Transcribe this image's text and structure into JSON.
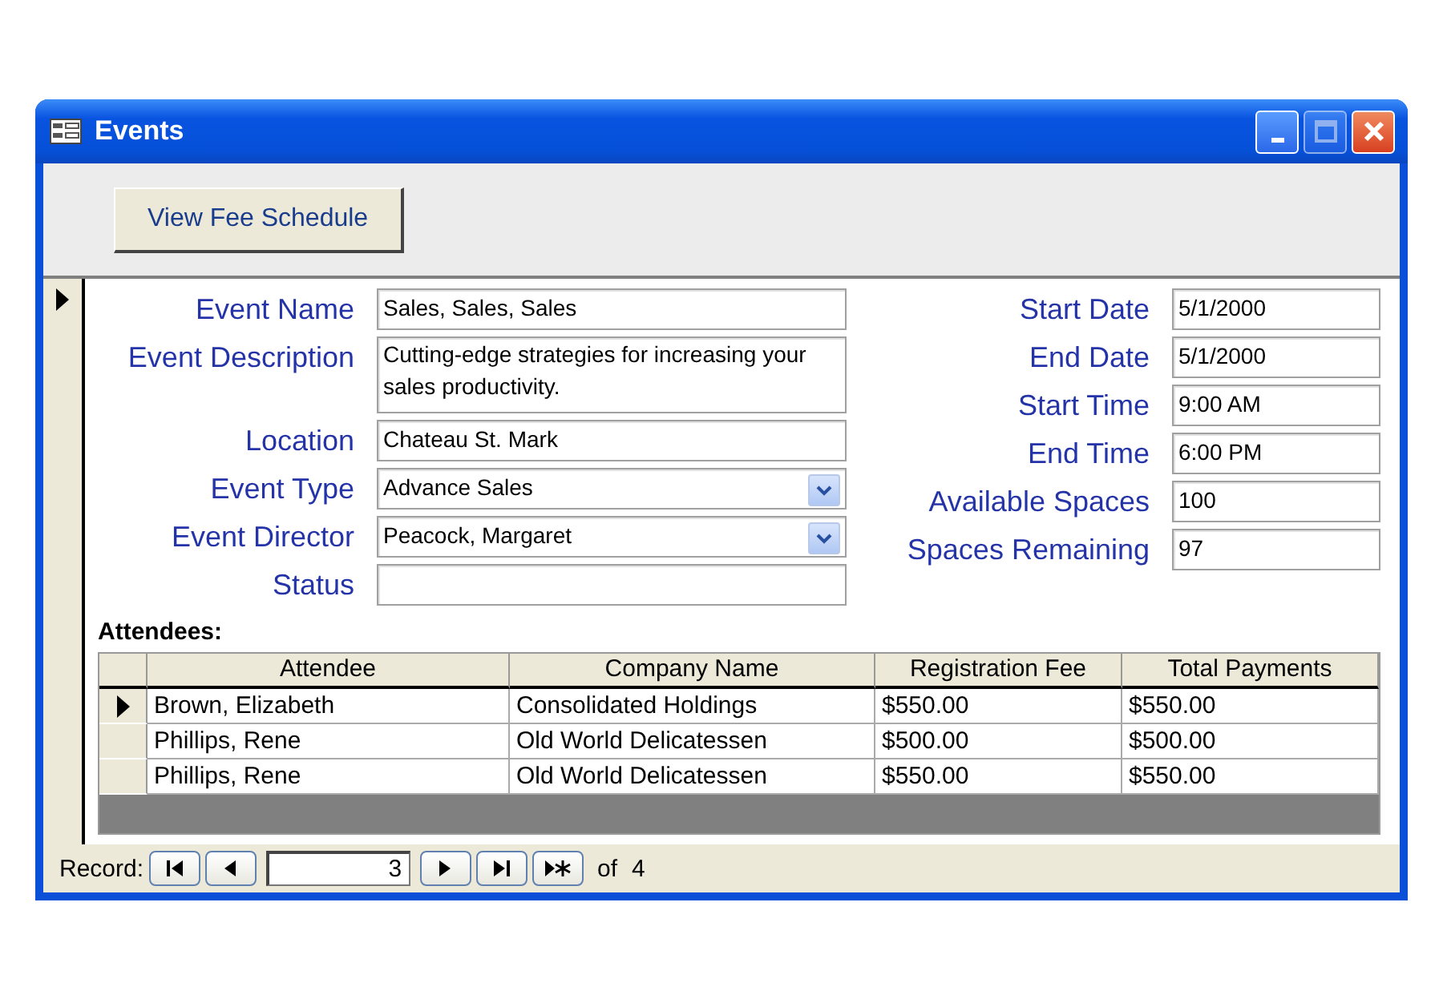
{
  "window": {
    "title": "Events"
  },
  "header": {
    "button": "View Fee Schedule"
  },
  "left_fields": [
    {
      "label": "Event Name",
      "value": "Sales, Sales, Sales",
      "kind": "text"
    },
    {
      "label": "Event Description",
      "value": "Cutting-edge strategies for increasing your sales productivity.",
      "kind": "multiline"
    },
    {
      "label": "Location",
      "value": "Chateau St. Mark",
      "kind": "text"
    },
    {
      "label": "Event Type",
      "value": "Advance Sales",
      "kind": "combo"
    },
    {
      "label": "Event Director",
      "value": "Peacock, Margaret",
      "kind": "combo"
    },
    {
      "label": "Status",
      "kind": "text"
    }
  ],
  "right_fields": [
    {
      "label": "Start Date",
      "value": "5/1/2000"
    },
    {
      "label": "End Date",
      "value": "5/1/2000"
    },
    {
      "label": "Start Time",
      "value": "9:00 AM"
    },
    {
      "label": "End Time",
      "value": "6:00 PM"
    },
    {
      "label": "Available Spaces",
      "value": "100"
    },
    {
      "label": "Spaces Remaining",
      "value": "97"
    }
  ],
  "attendees": {
    "title": "Attendees:",
    "columns": [
      "Attendee",
      "Company Name",
      "Registration Fee",
      "Total Payments"
    ],
    "rows": [
      {
        "selected": true,
        "cells": [
          "Brown, Elizabeth",
          "Consolidated Holdings",
          "$550.00",
          "$550.00"
        ]
      },
      {
        "selected": false,
        "cells": [
          "Phillips, Rene",
          "Old World Delicatessen",
          "$500.00",
          "$500.00"
        ]
      },
      {
        "selected": false,
        "cells": [
          "Phillips, Rene",
          "Old World Delicatessen",
          "$550.00",
          "$550.00"
        ]
      }
    ]
  },
  "navigation": {
    "label": "Record:",
    "current": "3",
    "of": "of",
    "total": "4"
  }
}
